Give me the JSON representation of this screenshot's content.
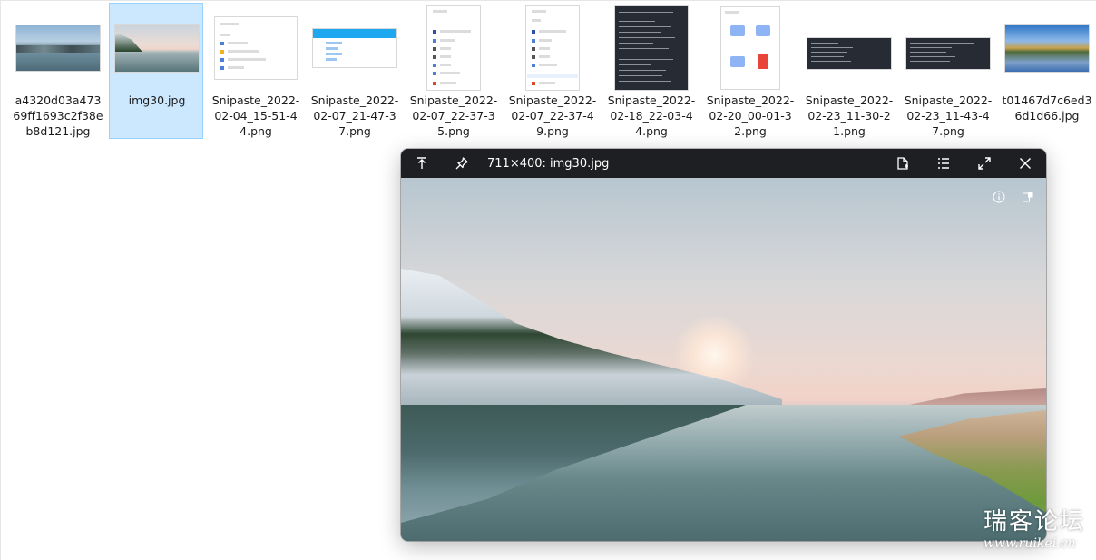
{
  "files": [
    {
      "name": "a4320d03a47369ff1693c2f38eb8d121.jpg",
      "selected": false,
      "thumb": "photo-lake"
    },
    {
      "name": "img30.jpg",
      "selected": true,
      "thumb": "photo-landscape"
    },
    {
      "name": "Snipaste_2022-02-04_15-51-44.png",
      "selected": false,
      "thumb": "screenshot-list"
    },
    {
      "name": "Snipaste_2022-02-07_21-47-37.png",
      "selected": false,
      "thumb": "screenshot-blue-header"
    },
    {
      "name": "Snipaste_2022-02-07_22-37-35.png",
      "selected": false,
      "thumb": "screenshot-menu"
    },
    {
      "name": "Snipaste_2022-02-07_22-37-49.png",
      "selected": false,
      "thumb": "screenshot-menu"
    },
    {
      "name": "Snipaste_2022-02-18_22-03-44.png",
      "selected": false,
      "thumb": "screenshot-dark"
    },
    {
      "name": "Snipaste_2022-02-20_00-01-32.png",
      "selected": false,
      "thumb": "screenshot-folders"
    },
    {
      "name": "Snipaste_2022-02-23_11-30-21.png",
      "selected": false,
      "thumb": "screenshot-dark-wide"
    },
    {
      "name": "Snipaste_2022-02-23_11-43-47.png",
      "selected": false,
      "thumb": "screenshot-dark-wide"
    },
    {
      "name": "t01467d7c6ed36d1d66.jpg",
      "selected": false,
      "thumb": "photo-lake-autumn"
    }
  ],
  "viewer": {
    "title": "711×400: img30.jpg",
    "toolbar": [
      "pin-top-icon",
      "pin-icon",
      "new-document-icon",
      "list-icon",
      "expand-icon",
      "close-icon"
    ],
    "overlay": [
      "info-icon",
      "compare-icon"
    ]
  },
  "watermark": {
    "title": "瑞客论坛",
    "url": "www.ruikei.cn"
  }
}
